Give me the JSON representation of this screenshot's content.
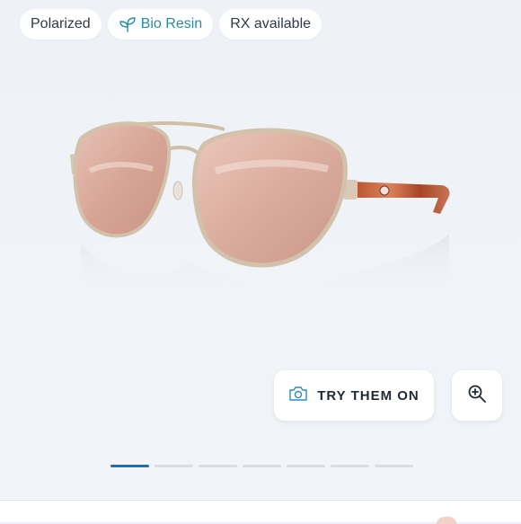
{
  "badges": [
    {
      "label": "Polarized",
      "icon": ""
    },
    {
      "label": "Bio Resin",
      "icon": "leaf-icon"
    },
    {
      "label": "RX available",
      "icon": ""
    }
  ],
  "product_image": {
    "alt": "aviator sunglasses with rose gold frame and copper silver mirror lenses"
  },
  "try_on": {
    "label": "TRY THEM ON",
    "icon": "camera-icon"
  },
  "zoom": {
    "icon": "zoom-in-icon"
  },
  "carousel": {
    "total": 7,
    "active_index": 0
  },
  "colors": {
    "accent": "#1f6fb3",
    "bio_text": "#2b8c9a",
    "background": "#eef2f6"
  }
}
